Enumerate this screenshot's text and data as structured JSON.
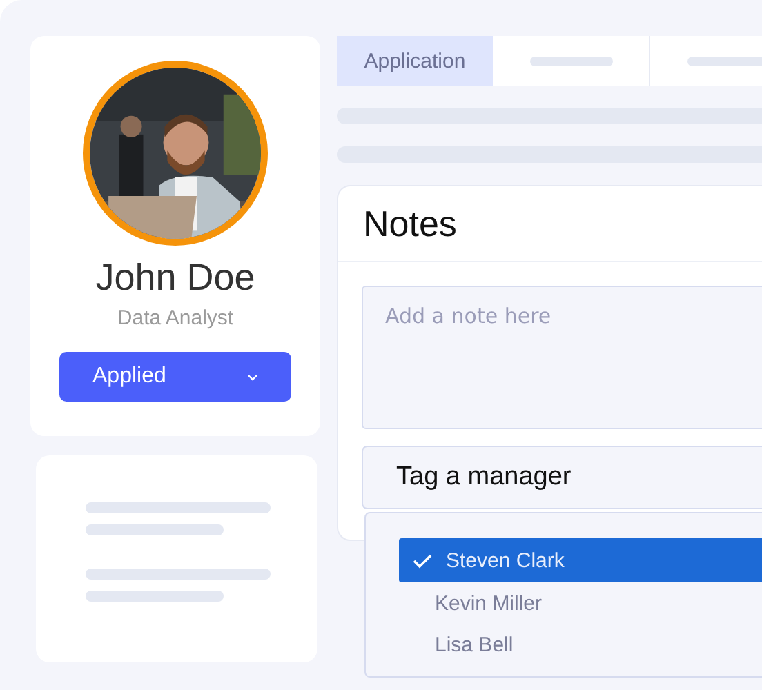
{
  "profile": {
    "name": "John Doe",
    "role": "Data Analyst",
    "status": "Applied"
  },
  "tabs": [
    {
      "label": "Application",
      "selected": true
    }
  ],
  "notes": {
    "title": "Notes",
    "note_field": {
      "placeholder": "Add a note here"
    },
    "manager_select": {
      "placeholder": "Tag a manager",
      "options": [
        {
          "label": "Steven Clark",
          "selected": true
        },
        {
          "label": "Kevin Miller",
          "selected": false
        },
        {
          "label": "Lisa Bell",
          "selected": false
        }
      ]
    }
  }
}
